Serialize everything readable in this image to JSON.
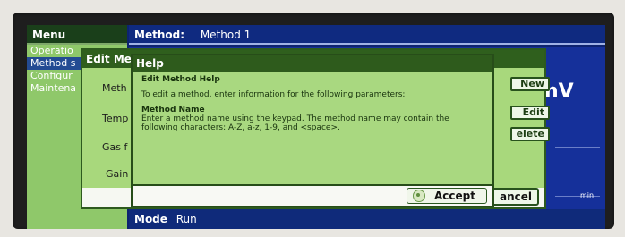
{
  "menu_bar": {
    "title": "Menu"
  },
  "method_bar": {
    "label": "Method:",
    "value": "Method 1"
  },
  "side_menu": {
    "items": [
      {
        "label": "Operatio",
        "selected": false
      },
      {
        "label": "Method s",
        "selected": true
      },
      {
        "label": "Configur",
        "selected": false
      },
      {
        "label": "Maintena",
        "selected": false
      }
    ]
  },
  "edit_method": {
    "title": "Edit Me",
    "labels": [
      "Meth",
      "Temp",
      "Gas f",
      "Gain"
    ],
    "buttons": {
      "new": "New",
      "edit": "Edit",
      "delete": "elete",
      "cancel": "ancel"
    }
  },
  "background_readout": {
    "unit": "nV",
    "min_label": "min"
  },
  "help_dialog": {
    "title": "Help",
    "heading": "Edit Method Help",
    "intro": "To edit a method, enter information for the following parameters:",
    "section_title": "Method Name",
    "section_text": "Enter a method name using the keypad. The method name may contain the following characters: A-Z, a-z, 1-9, and <space>.",
    "accept_label": "Accept"
  },
  "bottom_bar": {
    "mode_label": "Mode",
    "mode_value": "Run"
  },
  "colors": {
    "screen_blue": "#0d2370",
    "dialog_green": "#a8d87c",
    "title_green": "#2f5f1d",
    "menu_green": "#8fc86a",
    "selected_blue": "#234b93"
  }
}
